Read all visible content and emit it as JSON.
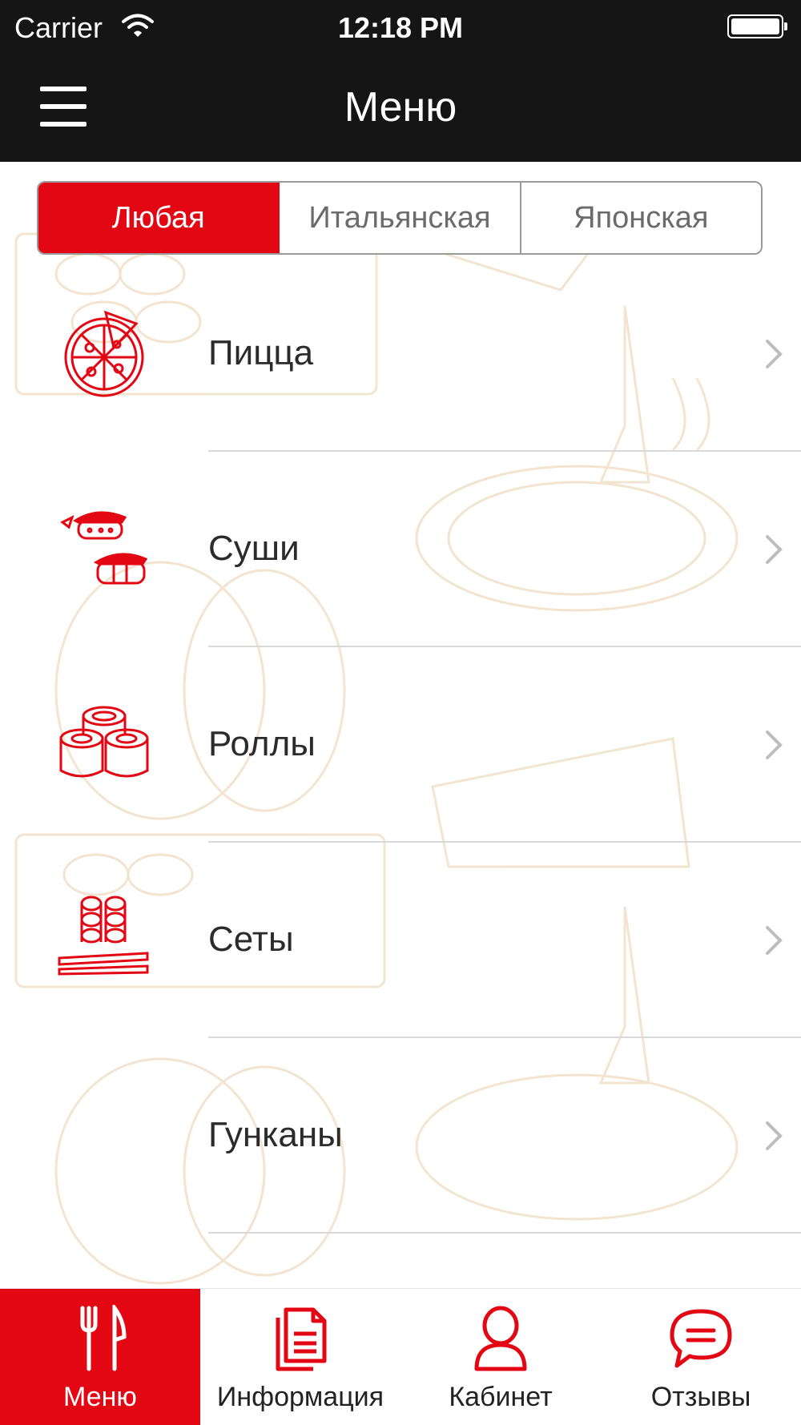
{
  "status_bar": {
    "carrier": "Carrier",
    "time": "12:18 PM"
  },
  "nav": {
    "title": "Меню"
  },
  "segments": [
    {
      "label": "Любая",
      "active": true
    },
    {
      "label": "Итальянская",
      "active": false
    },
    {
      "label": "Японская",
      "active": false
    }
  ],
  "menu_items": [
    {
      "label": "Пицца",
      "icon": "pizza-icon"
    },
    {
      "label": "Суши",
      "icon": "sushi-icon"
    },
    {
      "label": "Роллы",
      "icon": "rolls-icon"
    },
    {
      "label": "Сеты",
      "icon": "sets-icon"
    },
    {
      "label": "Гунканы",
      "icon": ""
    }
  ],
  "tabs": [
    {
      "label": "Меню",
      "icon": "fork-knife-icon",
      "active": true
    },
    {
      "label": "Информация",
      "icon": "document-icon",
      "active": false
    },
    {
      "label": "Кабинет",
      "icon": "user-icon",
      "active": false
    },
    {
      "label": "Отзывы",
      "icon": "chat-icon",
      "active": false
    }
  ],
  "colors": {
    "accent": "#e30613",
    "bar": "#151515",
    "separator": "#d9d9d9"
  }
}
